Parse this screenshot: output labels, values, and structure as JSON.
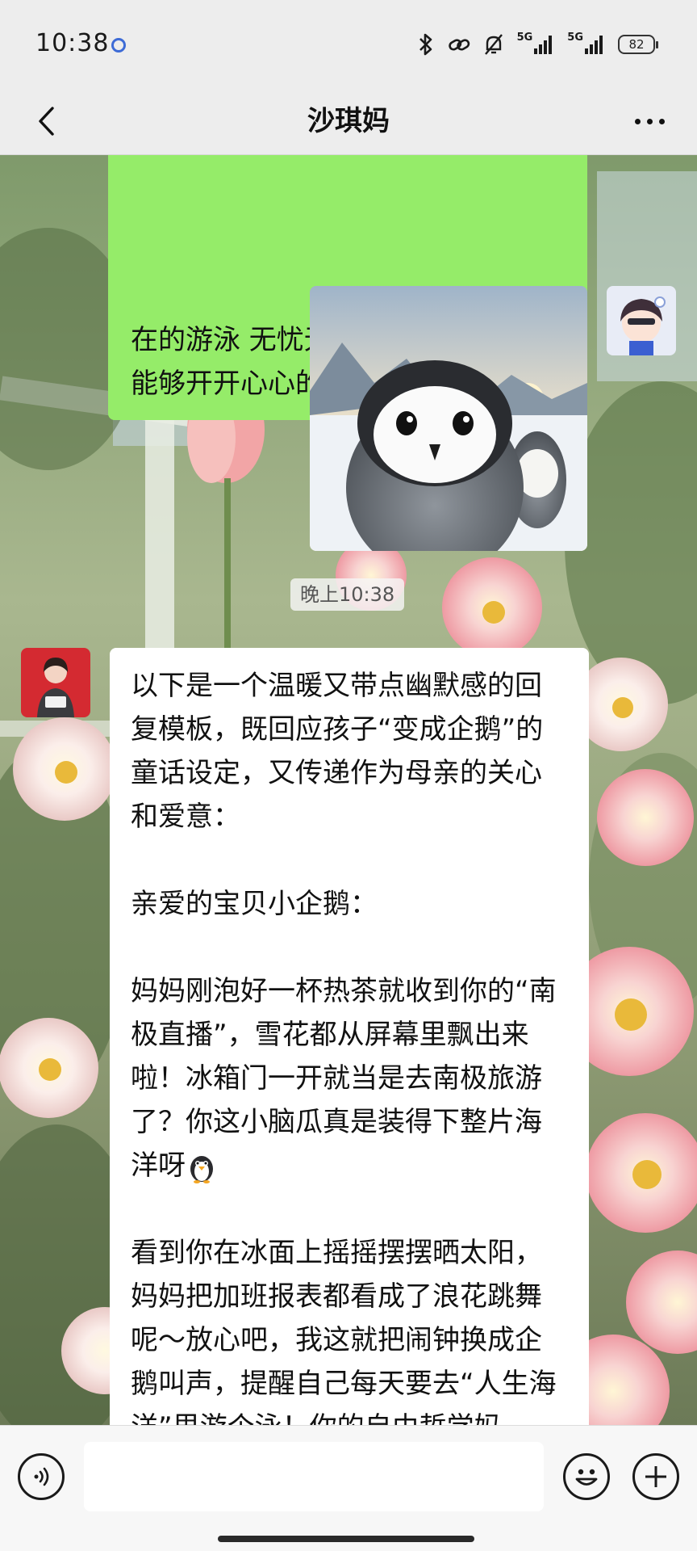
{
  "status_bar": {
    "time": "10:38",
    "network_1": "5G",
    "network_2": "5G",
    "battery": "82",
    "icons": [
      "bluetooth-icon",
      "link-icon",
      "mute-bell-icon",
      "signal-icon",
      "signal-icon",
      "battery-icon"
    ]
  },
  "nav": {
    "title": "沙琪妈",
    "back_icon": "chevron-left-icon",
    "more_icon": "more-dots-icon"
  },
  "messages": {
    "sent_text": "在的游泳 无忧无虑的嬉戏 希望你也能够开开心心的过每一天",
    "sent_image": "penguin-chick-photo",
    "timestamp": "晚上10:38",
    "reply_paragraphs": [
      "以下是一个温暖又带点幽默感的回复模板，既回应孩子“变成企鹅”的童话设定，又传递作为母亲的关心和爱意：",
      "亲爱的宝贝小企鹅：",
      "妈妈刚泡好一杯热茶就收到你的“南极直播”，雪花都从屏幕里飘出来啦！冰箱门一开就当是去南极旅游了？你这小脑瓜真是装得下整片海洋呀",
      "看到你在冰面上摇摇摆摆晒太阳，妈妈把加班报表都看成了浪花跳舞呢～放心吧，我这就把闹钟换成企鹅叫声，提醒自己每天要去“人生海洋”里游个泳！你的自由哲学妈"
    ],
    "inline_emoji": "penguin-emoji"
  },
  "input_bar": {
    "voice_icon": "voice-icon",
    "input_value": "",
    "input_placeholder": "",
    "emoji_icon": "emoji-face-icon",
    "plus_icon": "plus-icon"
  },
  "colors": {
    "sent_bubble": "#95ec69",
    "received_bubble": "#ffffff",
    "bar_background": "#ededed"
  }
}
